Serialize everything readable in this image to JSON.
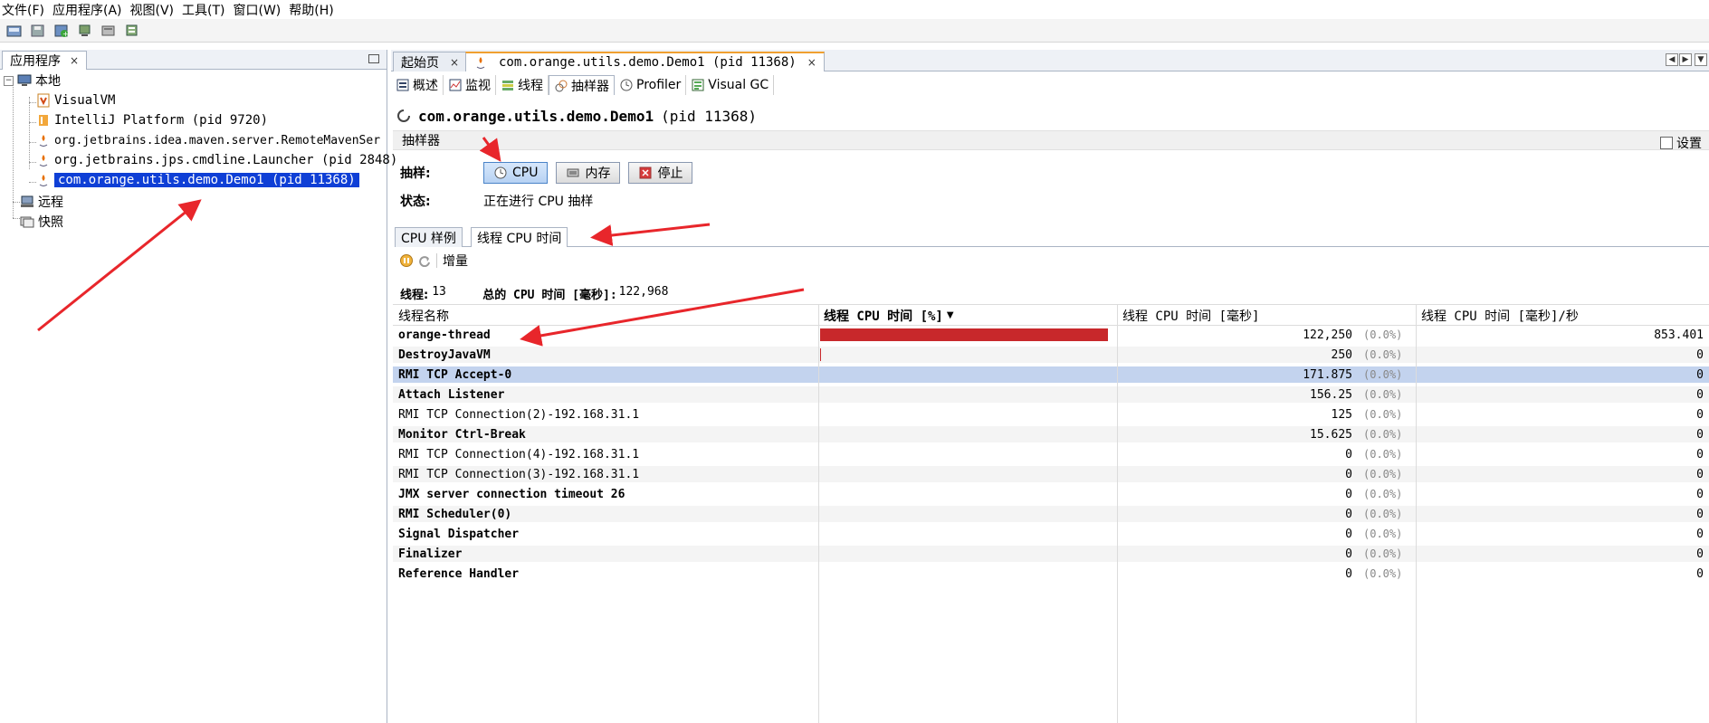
{
  "menubar": {
    "items": [
      "文件(F)",
      "应用程序(A)",
      "视图(V)",
      "工具(T)",
      "窗口(W)",
      "帮助(H)"
    ]
  },
  "left_panel": {
    "tab_label": "应用程序",
    "tab_close": "×",
    "tree": {
      "local": "本地",
      "local_children": [
        "VisualVM",
        "IntelliJ Platform (pid 9720)",
        "org.jetbrains.idea.maven.server.RemoteMavenSer",
        "org.jetbrains.jps.cmdline.Launcher (pid 2848)",
        "com.orange.utils.demo.Demo1 (pid 11368)"
      ],
      "remote": "远程",
      "snapshots": "快照"
    }
  },
  "doc_tabs": {
    "start_page": "起始页",
    "active": "com.orange.utils.demo.Demo1 (pid 11368)",
    "close": "×"
  },
  "sub_tabs": [
    "概述",
    "监视",
    "线程",
    "抽样器",
    "Profiler",
    "Visual GC"
  ],
  "app_title": {
    "name": "com.orange.utils.demo.Demo1",
    "pid": "(pid 11368)"
  },
  "sampler": {
    "header": "抽样器",
    "settings_label": "设置",
    "sample_label": "抽样:",
    "cpu_button": "CPU",
    "memory_button": "内存",
    "stop_button": "停止",
    "status_label": "状态:",
    "status_value": "正在进行 CPU 抽样"
  },
  "view_tabs": [
    "CPU 样例",
    "线程 CPU 时间"
  ],
  "delta_label": "增量",
  "summary": {
    "threads_label": "线程:",
    "threads_value": "13",
    "total_label": "总的 CPU 时间 [毫秒]:",
    "total_value": "122,968"
  },
  "table": {
    "columns": [
      "线程名称",
      "线程 CPU 时间 [%]",
      "线程 CPU 时间 [毫秒]",
      "线程 CPU 时间 [毫秒]/秒"
    ],
    "sort_indicator": "▼",
    "bar_color": "#c8282b",
    "rows": [
      {
        "name": "orange-thread",
        "bold": true,
        "fraction": 1.0,
        "ms": "122,250",
        "pct": "(0.0%)",
        "per_sec": "853.401"
      },
      {
        "name": "DestroyJavaVM",
        "bold": true,
        "fraction": 0.002,
        "ms": "250",
        "pct": "(0.0%)",
        "per_sec": "0"
      },
      {
        "name": "RMI TCP Accept-0",
        "bold": true,
        "fraction": 0,
        "ms": "171.875",
        "pct": "(0.0%)",
        "per_sec": "0"
      },
      {
        "name": "Attach Listener",
        "bold": true,
        "fraction": 0,
        "ms": "156.25",
        "pct": "(0.0%)",
        "per_sec": "0"
      },
      {
        "name": "RMI TCP Connection(2)-192.168.31.1",
        "bold": false,
        "fraction": 0,
        "ms": "125",
        "pct": "(0.0%)",
        "per_sec": "0"
      },
      {
        "name": "Monitor Ctrl-Break",
        "bold": true,
        "fraction": 0,
        "ms": "15.625",
        "pct": "(0.0%)",
        "per_sec": "0"
      },
      {
        "name": "RMI TCP Connection(4)-192.168.31.1",
        "bold": false,
        "fraction": 0,
        "ms": "0",
        "pct": "(0.0%)",
        "per_sec": "0"
      },
      {
        "name": "RMI TCP Connection(3)-192.168.31.1",
        "bold": false,
        "fraction": 0,
        "ms": "0",
        "pct": "(0.0%)",
        "per_sec": "0"
      },
      {
        "name": "JMX server connection timeout 26",
        "bold": true,
        "fraction": 0,
        "ms": "0",
        "pct": "(0.0%)",
        "per_sec": "0"
      },
      {
        "name": "RMI Scheduler(0)",
        "bold": true,
        "fraction": 0,
        "ms": "0",
        "pct": "(0.0%)",
        "per_sec": "0"
      },
      {
        "name": "Signal Dispatcher",
        "bold": true,
        "fraction": 0,
        "ms": "0",
        "pct": "(0.0%)",
        "per_sec": "0"
      },
      {
        "name": "Finalizer",
        "bold": true,
        "fraction": 0,
        "ms": "0",
        "pct": "(0.0%)",
        "per_sec": "0"
      },
      {
        "name": "Reference Handler",
        "bold": true,
        "fraction": 0,
        "ms": "0",
        "pct": "(0.0%)",
        "per_sec": "0"
      }
    ],
    "selected_row": "RMI TCP Accept-0"
  },
  "annotations": {
    "arrow_color": "#e8262b"
  }
}
